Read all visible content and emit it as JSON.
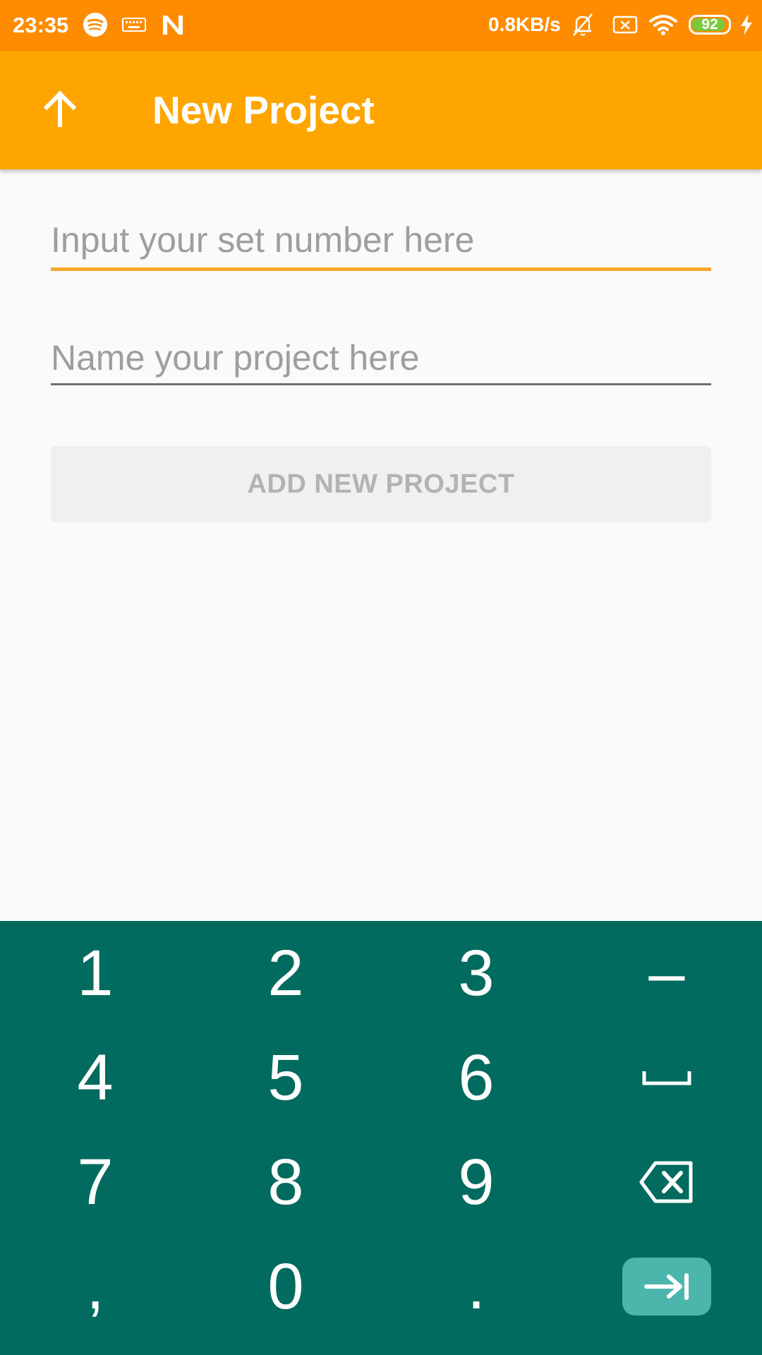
{
  "status_bar": {
    "time": "23:35",
    "net_speed": "0.8KB/s",
    "battery_percent": "92",
    "battery_level": 0.92,
    "icons": [
      "spotify-icon",
      "keyboard-icon",
      "n-app-icon",
      "bell-muted-icon",
      "sim-off-icon",
      "wifi-icon",
      "battery-icon",
      "charging-icon"
    ]
  },
  "app_bar": {
    "title": "New Project",
    "up_icon": "arrow-up-icon"
  },
  "form": {
    "set_number_placeholder": "Input your set number here",
    "set_number_value": "",
    "project_name_placeholder": "Name your project here",
    "project_name_value": "",
    "add_button_label": "ADD NEW PROJECT"
  },
  "keyboard": {
    "rows": [
      [
        "1",
        "2",
        "3",
        "-"
      ],
      [
        "4",
        "5",
        "6",
        "space"
      ],
      [
        "7",
        "8",
        "9",
        "backspace"
      ],
      [
        ",",
        "0",
        ".",
        "next"
      ]
    ],
    "labels": {
      "k1": "1",
      "k2": "2",
      "k3": "3",
      "dash": "–",
      "k4": "4",
      "k5": "5",
      "k6": "6",
      "k7": "7",
      "k8": "8",
      "k9": "9",
      "comma": ",",
      "k0": "0",
      "period": "."
    }
  },
  "colors": {
    "status_bar": "#ff8c00",
    "app_bar": "#ffa500",
    "accent_underline": "#f4a92a",
    "keyboard_bg": "#006b5e",
    "enter_key": "#4db6ac",
    "button_disabled_bg": "#eff0f0",
    "button_disabled_text": "#b3b3b3"
  }
}
